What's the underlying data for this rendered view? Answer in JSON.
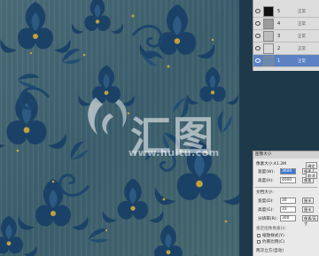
{
  "layers": [
    {
      "name": "5",
      "mode": "正常",
      "thumb_color": "#111111",
      "selected": false
    },
    {
      "name": "4",
      "mode": "正常",
      "thumb_color": "#9a9a9a",
      "selected": false
    },
    {
      "name": "3",
      "mode": "正常",
      "thumb_color": "#bcbcbc",
      "selected": false
    },
    {
      "name": "2",
      "mode": "正常",
      "thumb_color": "#d8d8d8",
      "selected": false
    },
    {
      "name": "1",
      "mode": "正常",
      "thumb_color": "#6a8ab0",
      "selected": true
    }
  ],
  "dialog": {
    "title": "图像大小",
    "pixel_dimensions": "像素大小:41.2M",
    "width_label": "宽度(W):",
    "width_value": "3600",
    "height_label": "高度(H):",
    "height_value": "4000",
    "pixel_unit": "像素",
    "doc_size_label": "文档大小:",
    "doc_width_label": "宽度(D):",
    "doc_width_value": "30",
    "doc_height_label": "高度(G):",
    "doc_height_value": "33",
    "cm_unit": "厘米",
    "resolution_label": "分辨率(R):",
    "resolution_value": "300",
    "resolution_unit": "像素/英寸",
    "scale_styles": "缩放样式(Y)",
    "constrain": "约束比例(C)",
    "resample": "重定图像像素(I):",
    "resample_method": "两次立方(自动)"
  },
  "dialog_buttons": {
    "ok": "确定",
    "cancel": "取消",
    "auto": "自动(A)..."
  },
  "watermark": {
    "brand": "汇图",
    "url": "www.huitu.com"
  },
  "colors": {
    "canvas_base": "#3e6270",
    "pattern_dark": "#173a5c",
    "pattern_mid": "#2a5278",
    "accent_gold": "#b59a3a",
    "selected_layer": "#5c82c4"
  }
}
